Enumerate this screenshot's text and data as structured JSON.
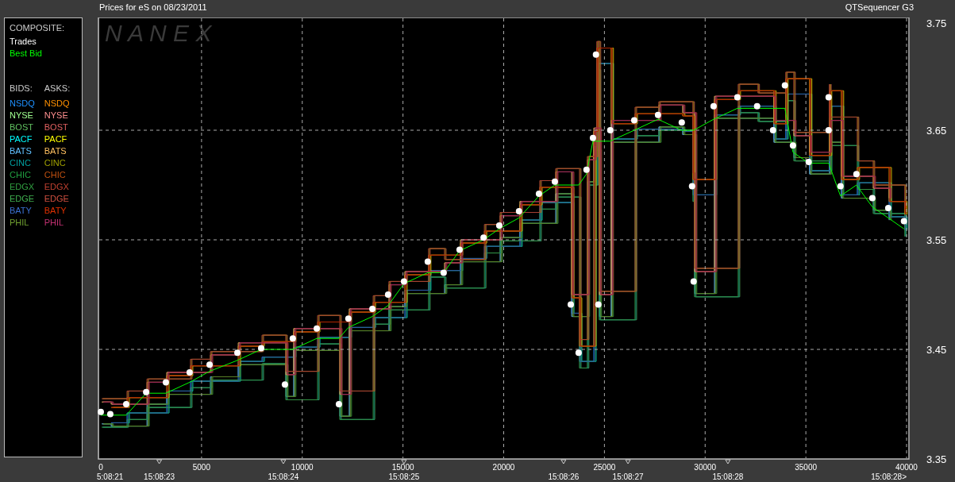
{
  "header": {
    "title": "Prices for  eS  on  08/23/2011",
    "product": "QTSequencer G3"
  },
  "legend": {
    "composite_heading": "COMPOSITE:",
    "bids_heading": "BIDS:",
    "asks_heading": "ASKS:",
    "bids": [
      {
        "label": "NSDQ",
        "color": "#1e90ff"
      },
      {
        "label": "NYSE",
        "color": "#a0ff90"
      },
      {
        "label": "BOST",
        "color": "#60c060"
      },
      {
        "label": "PACF",
        "color": "#00ffff"
      },
      {
        "label": "BATS",
        "color": "#60c0ff"
      },
      {
        "label": "CINC",
        "color": "#00a0a0"
      },
      {
        "label": "CHIC",
        "color": "#20a040"
      },
      {
        "label": "EDGX",
        "color": "#30a040"
      },
      {
        "label": "EDGE",
        "color": "#40b050"
      },
      {
        "label": "BATY",
        "color": "#3a70d0"
      },
      {
        "label": "PHIL",
        "color": "#70a030"
      }
    ],
    "asks": [
      {
        "label": "NSDQ",
        "color": "#ff9000"
      },
      {
        "label": "NYSE",
        "color": "#ff9090"
      },
      {
        "label": "BOST",
        "color": "#e06060"
      },
      {
        "label": "PACF",
        "color": "#ffff00"
      },
      {
        "label": "BATS",
        "color": "#ffc060"
      },
      {
        "label": "CINC",
        "color": "#a0a000"
      },
      {
        "label": "CHIC",
        "color": "#c05010"
      },
      {
        "label": "EDGX",
        "color": "#c04030"
      },
      {
        "label": "EDGE",
        "color": "#d05040"
      },
      {
        "label": "BATY",
        "color": "#e03000"
      },
      {
        "label": "PHIL",
        "color": "#c03070"
      }
    ]
  },
  "logo": "N A N E X",
  "chart_data": {
    "type": "scatter",
    "grid": true,
    "xlim": [
      0,
      40000
    ],
    "ylim": [
      3.35,
      3.75
    ],
    "xticks": [
      0,
      5000,
      10000,
      15000,
      20000,
      25000,
      30000,
      35000,
      40000
    ],
    "yticks": [
      {
        "value": 3.75,
        "label": "3.75"
      },
      {
        "value": 3.65,
        "label": "3.65"
      },
      {
        "value": 3.55,
        "label": "3.55"
      },
      {
        "value": 3.45,
        "label": "3.45"
      },
      {
        "value": 3.35,
        "label": "3.35"
      }
    ],
    "x": [
      0,
      470,
      1260,
      2250,
      3230,
      4410,
      5400,
      6780,
      7960,
      9140,
      9530,
      10720,
      11820,
      12290,
      13480,
      14260,
      15050,
      16230,
      17020,
      17810,
      19000,
      19780,
      20760,
      21750,
      22540,
      23330,
      23720,
      24110,
      24430,
      24580,
      24700,
      25290,
      26480,
      27660,
      28840,
      29350,
      29430,
      30420,
      31600,
      32580,
      33370,
      33960,
      34360,
      35140,
      36130,
      36130,
      36720,
      37510,
      38300,
      39090,
      39870
    ],
    "series": [
      {
        "name": "Trades",
        "color": "#ffffff",
        "values": [
          3.393,
          3.391,
          3.4,
          3.411,
          3.42,
          3.429,
          3.436,
          3.447,
          3.451,
          3.418,
          3.46,
          3.469,
          3.4,
          3.478,
          3.487,
          3.5,
          3.512,
          3.53,
          3.52,
          3.541,
          3.552,
          3.563,
          3.576,
          3.592,
          3.603,
          3.491,
          3.447,
          3.614,
          3.643,
          3.719,
          3.491,
          3.65,
          3.659,
          3.664,
          3.657,
          3.599,
          3.512,
          3.672,
          3.68,
          3.672,
          3.65,
          3.691,
          3.636,
          3.621,
          3.68,
          3.65,
          3.599,
          3.61,
          3.588,
          3.579,
          3.567
        ]
      },
      {
        "name": "Best Bid",
        "color": "#00ff00",
        "type": "line",
        "values": [
          3.39,
          null,
          3.39,
          3.41,
          3.41,
          3.42,
          3.43,
          3.44,
          3.45,
          3.45,
          3.45,
          3.46,
          3.46,
          3.47,
          3.48,
          3.49,
          3.51,
          3.52,
          3.52,
          3.54,
          3.55,
          3.56,
          3.57,
          3.59,
          3.6,
          3.6,
          3.6,
          3.61,
          3.64,
          3.64,
          3.64,
          3.64,
          3.65,
          3.66,
          3.65,
          3.65,
          3.65,
          3.66,
          3.67,
          3.67,
          3.67,
          3.67,
          3.63,
          3.62,
          3.62,
          3.62,
          3.59,
          3.6,
          3.58,
          3.57,
          3.56
        ]
      }
    ]
  },
  "time_axis": {
    "labels": [
      "5:08:21",
      "15:08:23",
      "15:08:24",
      "15:08:25",
      "15:08:26",
      "15:08:27",
      "15:08:28",
      "15:08:28>"
    ]
  }
}
